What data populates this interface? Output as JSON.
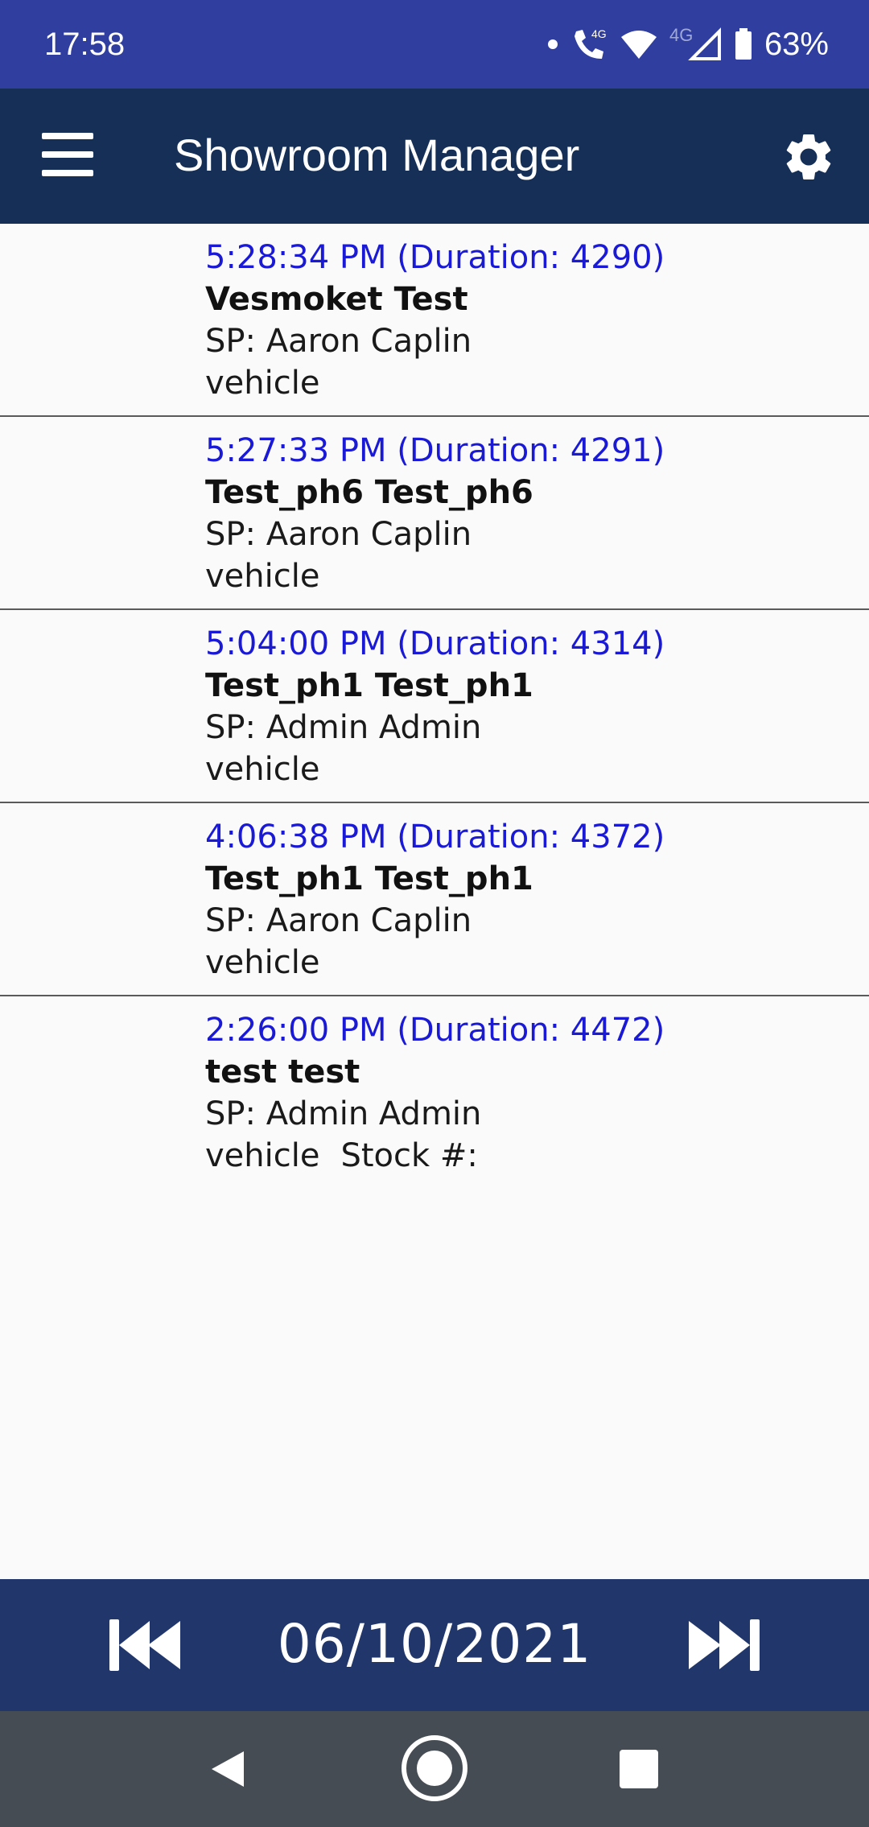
{
  "status_bar": {
    "time": "17:58",
    "battery_pct": "63%",
    "network_label": "4G",
    "icons": [
      "notification-dot-icon",
      "volte-call-icon",
      "wifi-icon",
      "signal-icon",
      "battery-icon"
    ]
  },
  "app_bar": {
    "title": "Showroom Manager",
    "menu_icon": "hamburger-menu-icon",
    "settings_icon": "gear-icon"
  },
  "appointments": [
    {
      "time": "5:28:34 PM (Duration: 4290)",
      "name": "Vesmoket Test",
      "sp": "SP: Aaron Caplin",
      "vehicle": "vehicle",
      "stock": ""
    },
    {
      "time": "5:27:33 PM (Duration: 4291)",
      "name": "Test_ph6 Test_ph6",
      "sp": "SP: Aaron Caplin",
      "vehicle": "vehicle",
      "stock": ""
    },
    {
      "time": "5:04:00 PM (Duration: 4314)",
      "name": "Test_ph1 Test_ph1",
      "sp": "SP: Admin Admin",
      "vehicle": "vehicle",
      "stock": ""
    },
    {
      "time": "4:06:38 PM (Duration: 4372)",
      "name": "Test_ph1 Test_ph1",
      "sp": "SP: Aaron Caplin",
      "vehicle": "vehicle",
      "stock": ""
    },
    {
      "time": "2:26:00 PM (Duration: 4472)",
      "name": "test test",
      "sp": "SP: Admin Admin",
      "vehicle": "vehicle",
      "stock": "Stock #:"
    }
  ],
  "date_nav": {
    "date": "06/10/2021",
    "prev_icon": "skip-previous-icon",
    "next_icon": "skip-next-icon"
  },
  "colors": {
    "status_bar": "#303f9f",
    "app_bar": "#162f56",
    "date_bar": "#21366a",
    "nav_bar": "#454c53",
    "time_text": "#1a1ad6"
  }
}
